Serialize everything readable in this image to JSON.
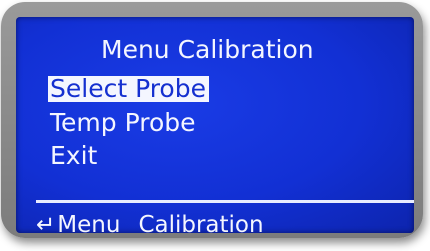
{
  "screen": {
    "title": "Menu Calibration",
    "menu_items": [
      {
        "label": "Select Probe",
        "selected": true
      },
      {
        "label": "Temp Probe",
        "selected": false
      },
      {
        "label": "Exit",
        "selected": false
      }
    ],
    "footer": {
      "back_icon": "return-arrow-icon",
      "back_symbol": "↵",
      "menu_label": "Menu",
      "section_label": "Calibration"
    }
  },
  "colors": {
    "lcd_background": "#1230d4",
    "lcd_text": "#f4f6ff",
    "bezel": "#8a8a8a"
  }
}
